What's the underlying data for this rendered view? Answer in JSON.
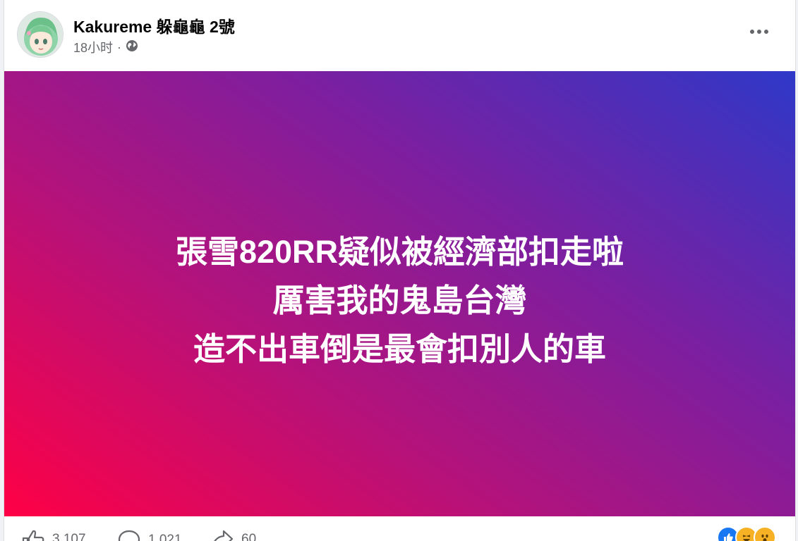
{
  "post": {
    "author": "Kakureme 躲龜龜 2號",
    "time": "18小时",
    "separator": "·",
    "privacy_icon": "globe-icon",
    "menu_icon": "more-options-icon"
  },
  "banner": {
    "lines": [
      "張雪820RR疑似被經濟部扣走啦",
      "厲害我的鬼島台灣",
      "造不出車倒是最會扣別人的車"
    ],
    "gradient_colors": [
      "#ff0045",
      "#b5127a",
      "#7c1fa0",
      "#2e38c8"
    ],
    "text_color": "#ffffff"
  },
  "footer": {
    "like_count": "3,107",
    "comment_count": "1,021",
    "share_count": "60",
    "reaction_icons": [
      "like-reaction-icon",
      "haha-reaction-icon",
      "wow-reaction-icon"
    ]
  },
  "colors": {
    "meta_text": "#65676b",
    "name_text": "#050505",
    "like_blue": "#1877f2",
    "reaction_yellow": "#f7b125"
  }
}
